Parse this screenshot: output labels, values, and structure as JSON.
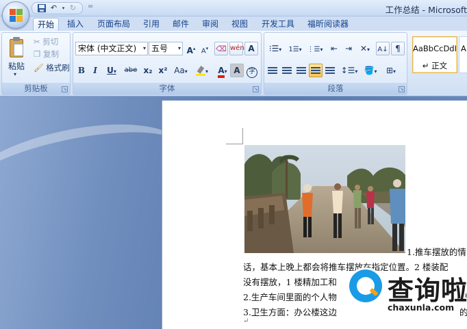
{
  "window": {
    "title": "工作总结 - Microsoft"
  },
  "qat": {
    "save_icon": "save-icon",
    "undo_icon": "undo-icon",
    "redo_icon": "redo-icon",
    "more": "="
  },
  "tabs": [
    "开始",
    "插入",
    "页面布局",
    "引用",
    "邮件",
    "审阅",
    "视图",
    "开发工具",
    "福昕阅读器"
  ],
  "clipboard": {
    "group_label": "剪贴板",
    "paste": "粘贴",
    "cut": "剪切",
    "copy": "复制",
    "format_painter": "格式刷"
  },
  "font": {
    "group_label": "字体",
    "name": "宋体 (中文正文)",
    "size": "五号",
    "grow": "A",
    "shrink": "A",
    "bold": "B",
    "italic": "I",
    "underline": "U",
    "strike": "abe",
    "subscript": "x₂",
    "superscript": "x²",
    "case": "Aa",
    "font_color_letter": "A",
    "char_shade": "A",
    "phonetic": "wén",
    "char_border": "A"
  },
  "paragraph": {
    "group_label": "段落"
  },
  "styles": {
    "preview": "AaBbCcDdI",
    "normal": "↵ 正文"
  },
  "document": {
    "lines": [
      "1.推车摆放的情",
      "话，基本上晚上都会将推车摆放在指定位置。2 楼装配",
      "没有摆放，1 楼精加工和",
      "2.生产车间里面的个人物",
      "3.卫生方面：办公楼这边",
      "↵"
    ],
    "frag_a": "基",
    "frag_b": "的"
  },
  "watermark": {
    "brand": "查询啦",
    "url": "chaxunla.com"
  },
  "colors": {
    "accent_blue": "#15428b",
    "ribbon_bg": "#dde9f8",
    "highlight_yellow": "#ffe600",
    "font_red": "#e01b1b"
  }
}
